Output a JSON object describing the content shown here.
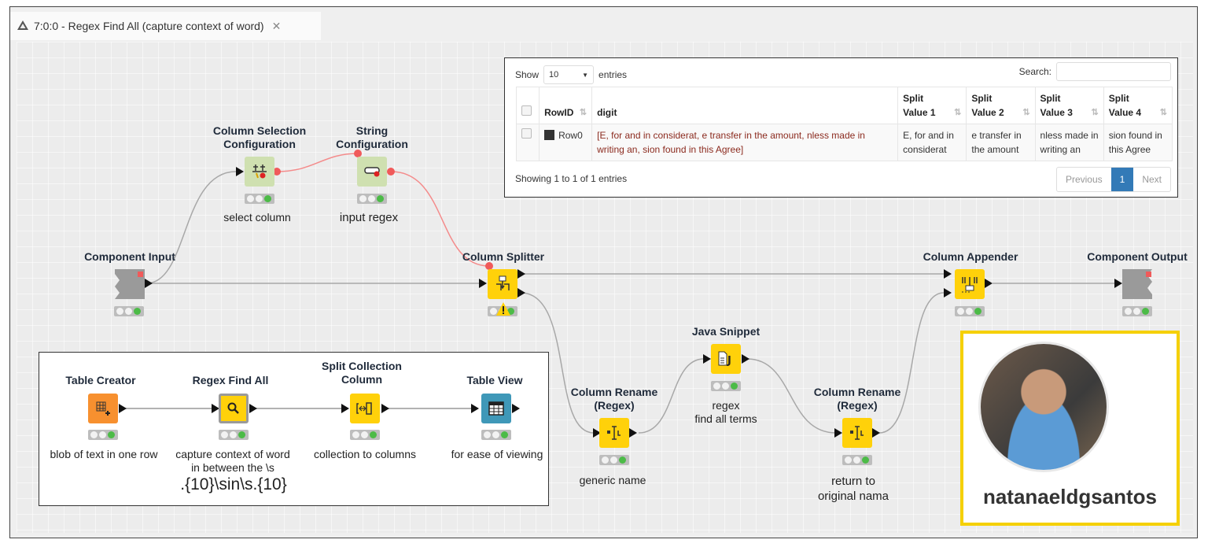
{
  "window": {
    "tab_title": "7:0:0 - Regex Find All (capture context of word)",
    "tab_icon": "warning-triangle-icon",
    "close_icon": "close-icon"
  },
  "nodes": {
    "component_input": {
      "title": "Component Input",
      "label": ""
    },
    "column_selection": {
      "title_line1": "Column Selection",
      "title_line2": "Configuration",
      "label": "select column"
    },
    "string_config": {
      "title_line1": "String",
      "title_line2": "Configuration",
      "label": "input regex"
    },
    "column_splitter": {
      "title": "Column Splitter",
      "label": ""
    },
    "column_appender": {
      "title": "Column Appender",
      "label": ""
    },
    "component_output": {
      "title": "Component Output",
      "label": ""
    },
    "java_snippet": {
      "title": "Java Snippet",
      "label_line1": "regex",
      "label_line2": "find all terms"
    },
    "rename1": {
      "title_line1": "Column Rename",
      "title_line2": "(Regex)",
      "label": "generic name"
    },
    "rename2": {
      "title_line1": "Column Rename",
      "title_line2": "(Regex)",
      "label_line1": "return to",
      "label_line2": "original nama"
    }
  },
  "annotation": {
    "table_creator": {
      "title": "Table Creator",
      "label": "blob of text in one row"
    },
    "regex_find_all": {
      "title": "Regex Find All",
      "label_line1": "capture context of word",
      "label_line2": "in between the \\s",
      "regex": ".{10}\\sin\\s.{10}"
    },
    "split_collection": {
      "title_line1": "Split Collection",
      "title_line2": "Column",
      "label": "collection to columns"
    },
    "table_view": {
      "title": "Table View",
      "label": "for ease of viewing"
    }
  },
  "table": {
    "show_label": "Show",
    "entries_value": "10",
    "entries_label": "entries",
    "search_label": "Search:",
    "search_value": "",
    "columns": [
      "RowID",
      "digit",
      "Split Value 1",
      "Split Value 2",
      "Split Value 3",
      "Split Value 4"
    ],
    "split_header_top": "Split",
    "split_headers": [
      "Value 1",
      "Value 2",
      "Value 3",
      "Value 4"
    ],
    "rows": [
      {
        "rowid": "Row0",
        "digit": "[E, for and in considerat, e transfer in the amount, nless made in writing an, sion found in this Agree]",
        "split1": "E, for and in considerat",
        "split2": "e transfer in the amount",
        "split3": "nless made in writing an",
        "split4": "sion found in this Agree"
      }
    ],
    "info": "Showing 1 to 1 of 1 entries",
    "pager": {
      "previous": "Previous",
      "current": "1",
      "next": "Next"
    }
  },
  "profile": {
    "username": "natanaeldgsantos"
  },
  "colors": {
    "knime_yellow": "#ffd10a",
    "config_green": "#cfe0b0",
    "source_orange": "#f7902f",
    "view_blue": "#3f98b8",
    "flow_var_red": "#f06060",
    "pager_active": "#337ab7",
    "profile_border": "#f5d000"
  }
}
